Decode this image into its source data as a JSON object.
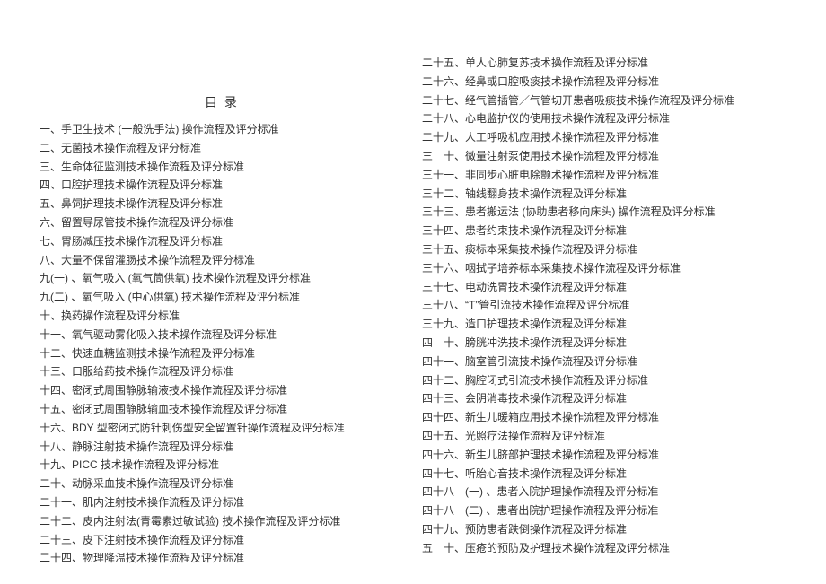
{
  "title": "目 录",
  "left_items": [
    "一、手卫生技术 (一般洗手法) 操作流程及评分标准",
    "二、无菌技术操作流程及评分标准",
    "三、生命体征监测技术操作流程及评分标准",
    "四、口腔护理技术操作流程及评分标准",
    "五、鼻饲护理技术操作流程及评分标准",
    "六、留置导尿管技术操作流程及评分标准",
    "七、胃肠减压技术操作流程及评分标准",
    "八、大量不保留灌肠技术操作流程及评分标准",
    "九(一) 、氧气吸入 (氧气筒供氧) 技术操作流程及评分标准",
    "九(二) 、氧气吸入 (中心供氧) 技术操作流程及评分标准",
    "十、换药操作流程及评分标准",
    "十一、氧气驱动雾化吸入技术操作流程及评分标准",
    "十二、快速血糖监测技术操作流程及评分标准",
    "十三、口服给药技术操作流程及评分标准",
    "十四、密闭式周围静脉输液技术操作流程及评分标准",
    "十五、密闭式周围静脉输血技术操作流程及评分标准",
    "十六、BDY 型密闭式防针刺伤型安全留置针操作流程及评分标准",
    "十八、静脉注射技术操作流程及评分标准",
    "十九、PICC 技术操作流程及评分标准",
    "二十、动脉采血技术操作流程及评分标准",
    "二十一、肌内注射技术操作流程及评分标准",
    "二十二、皮内注射法(青霉素过敏试验) 技术操作流程及评分标准",
    "二十三、皮下注射技术操作流程及评分标准",
    "二十四、物理降温技术操作流程及评分标准"
  ],
  "right_items": [
    "二十五、单人心肺复苏技术操作流程及评分标准",
    "二十六、经鼻或口腔吸痰技术操作流程及评分标准",
    "二十七、经气管插管／气管切开患者吸痰技术操作流程及评分标准",
    "二十八、心电监护仪的使用技术操作流程及评分标准",
    "二十九、人工呼吸机应用技术操作流程及评分标准",
    "三　十、微量注射泵使用技术操作流程及评分标准",
    "三十一、非同步心脏电除颤术操作流程及评分标准",
    "三十二、轴线翻身技术操作流程及评分标准",
    "三十三、患者搬运法 (协助患者移向床头) 操作流程及评分标准",
    "三十四、患者约束技术操作流程及评分标准",
    "三十五、痰标本采集技术操作流程及评分标准",
    "三十六、咽拭子培养标本采集技术操作流程及评分标准",
    "三十七、电动洗胃技术操作流程及评分标准",
    "三十八、“T”管引流技术操作流程及评分标准",
    "三十九、造口护理技术操作流程及评分标准",
    "四　十、膀胱冲洗技术操作流程及评分标准",
    "四十一、脑室管引流技术操作流程及评分标准",
    "四十二、胸腔闭式引流技术操作流程及评分标准",
    "四十三、会阴消毒技术操作流程及评分标准",
    "四十四、新生儿暖箱应用技术操作流程及评分标准",
    "四十五、光照疗法操作流程及评分标准",
    "四十六、新生儿脐部护理技术操作流程及评分标准",
    "四十七、听胎心音技术操作流程及评分标准",
    "四十八　(一) 、患者入院护理操作流程及评分标准",
    "四十八　(二) 、患者出院护理操作流程及评分标准",
    "四十九、预防患者跌倒操作流程及评分标准",
    "五　十、压疮的预防及护理技术操作流程及评分标准"
  ]
}
